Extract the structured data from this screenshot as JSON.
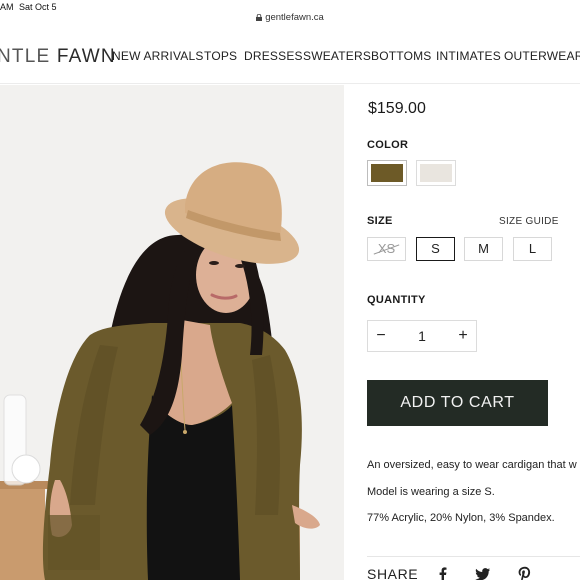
{
  "status_bar": {
    "time": "AM",
    "date": "Sat Oct 5"
  },
  "browser": {
    "url": "gentlefawn.ca"
  },
  "header": {
    "logo_light": "NTLE",
    "logo_bold": "FAWN",
    "nav": [
      "NEW ARRIVALS",
      "TOPS",
      "DRESSES",
      "SWEATERS",
      "BOTTOMS",
      "INTIMATES",
      "OUTERWEAR"
    ]
  },
  "product": {
    "price": "$159.00",
    "color_label": "COLOR",
    "colors": [
      {
        "name": "olive",
        "hex": "#6d5a27",
        "selected": true
      },
      {
        "name": "oatmeal",
        "hex": "#e9e5df",
        "selected": false
      }
    ],
    "size_label": "SIZE",
    "size_guide": "SIZE GUIDE",
    "sizes": [
      {
        "label": "XS",
        "available": false,
        "selected": false
      },
      {
        "label": "S",
        "available": true,
        "selected": true
      },
      {
        "label": "M",
        "available": true,
        "selected": false
      },
      {
        "label": "L",
        "available": true,
        "selected": false
      }
    ],
    "quantity_label": "QUANTITY",
    "quantity": "1",
    "add_to_cart": "ADD TO CART",
    "description": [
      "An oversized, easy to wear cardigan that w",
      "Model is wearing a size S.",
      "77% Acrylic, 20% Nylon, 3% Spandex."
    ],
    "share_label": "SHARE",
    "share_icons": [
      "facebook-icon",
      "twitter-icon",
      "pinterest-icon"
    ]
  },
  "colors": {
    "cart_button": "#232b25",
    "cardigan": "#6b5a2c",
    "hat": "#d9b48c"
  }
}
